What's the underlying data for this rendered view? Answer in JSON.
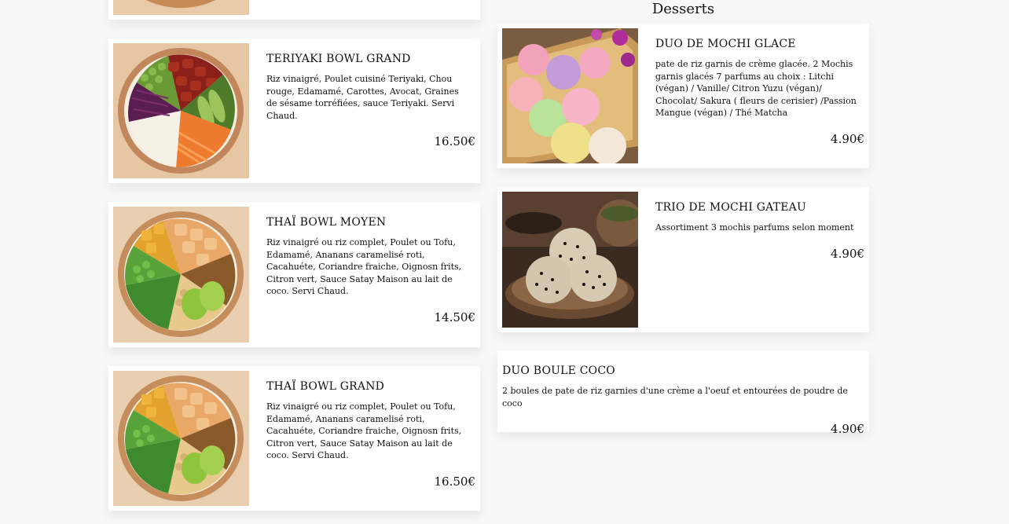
{
  "section": {
    "desserts_title": "Desserts"
  },
  "left_items": [
    {
      "name": "TERIYAKI BOWL GRAND",
      "description": "Riz vinaigré, Poulet cuisiné Teriyaki, Chou rouge, Edamamé, Carottes, Avocat, Graines de sésame torréfiées, sauce Teriyaki. Servi Chaud.",
      "price": "16.50€"
    },
    {
      "name": "THAÏ BOWL MOYEN",
      "description": "Riz vinaigré ou riz complet, Poulet ou Tofu, Edamamé, Ananans caramelisé roti, Cacahuéte, Coriandre fraiche, Oignosn frits, Citron vert, Sauce Satay Maison au lait de coco. Servi Chaud.",
      "price": "14.50€"
    },
    {
      "name": "THAÏ BOWL GRAND",
      "description": "Riz vinaigré ou riz complet, Poulet ou Tofu, Edamamé, Ananans caramelisé roti, Cacahuéte, Coriandre fraiche, Oignosn frits, Citron vert, Sauce Satay Maison au lait de coco. Servi Chaud.",
      "price": "16.50€"
    }
  ],
  "dessert_items": [
    {
      "name": "DUO DE MOCHI GLACE",
      "description": "pate de riz garnis de crème glacée. 2 Mochis garnis glacés 7 parfums au choix : Litchi (végan) / Vanille/ Citron Yuzu (végan)/ Chocolat/ Sakura ( fleurs de cerisier) /Passion Mangue (végan) / Thé Matcha",
      "price": "4.90€"
    },
    {
      "name": "TRIO DE MOCHI GATEAU",
      "description": "Assortiment 3 mochis parfums selon moment",
      "price": "4.90€"
    },
    {
      "name": "DUO BOULE COCO",
      "description": "2 boules de pate de riz garnies d'une crème a l'oeuf et entourées de poudre de coco",
      "price": "4.90€"
    }
  ]
}
